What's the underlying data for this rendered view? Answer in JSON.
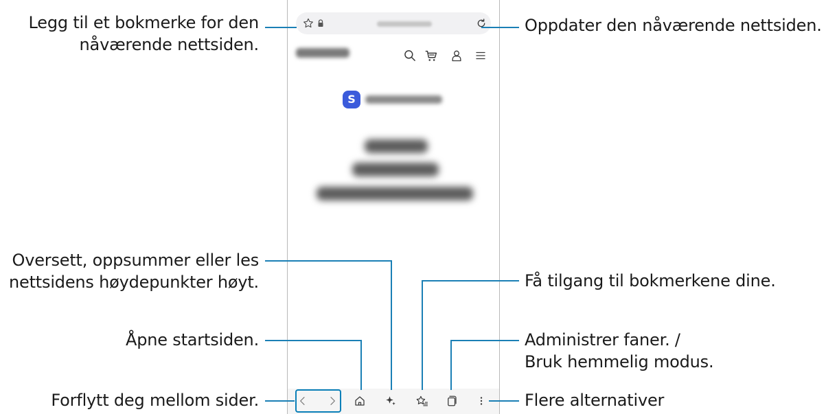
{
  "callouts": {
    "bookmark_add": {
      "line1": "Legg til et bokmerke for den",
      "line2": "nåværende nettsiden."
    },
    "refresh": "Oppdater den nåværende nettsiden.",
    "ai_tools": {
      "line1": "Oversett, oppsummer eller les",
      "line2": "nettsidens høydepunkter høyt."
    },
    "bookmarks": "Få tilgang til bokmerkene dine.",
    "home": "Åpne startsiden.",
    "tabs": {
      "line1": "Administrer faner. /",
      "line2": "Bruk hemmelig modus."
    },
    "navigate": "Forflytt deg mellom sider.",
    "more": "Flere alternativer"
  },
  "hero": {
    "badge_letter": "S"
  },
  "icons": {
    "toolbar_top": [
      "star-outline-icon",
      "lock-icon",
      "refresh-icon"
    ],
    "site_header": [
      "search-icon",
      "cart-icon",
      "account-icon",
      "menu-icon"
    ],
    "bottom_bar": [
      "back-icon",
      "forward-icon",
      "home-icon",
      "ai-sparkle-icon",
      "bookmarks-icon",
      "tabs-icon",
      "more-vert-icon"
    ]
  },
  "colors": {
    "leader_line": "#1a7fb5",
    "nav_highlight": "#0a7fb8",
    "badge_bg": "#3b5bdb",
    "icon": "#3a3a3a"
  }
}
